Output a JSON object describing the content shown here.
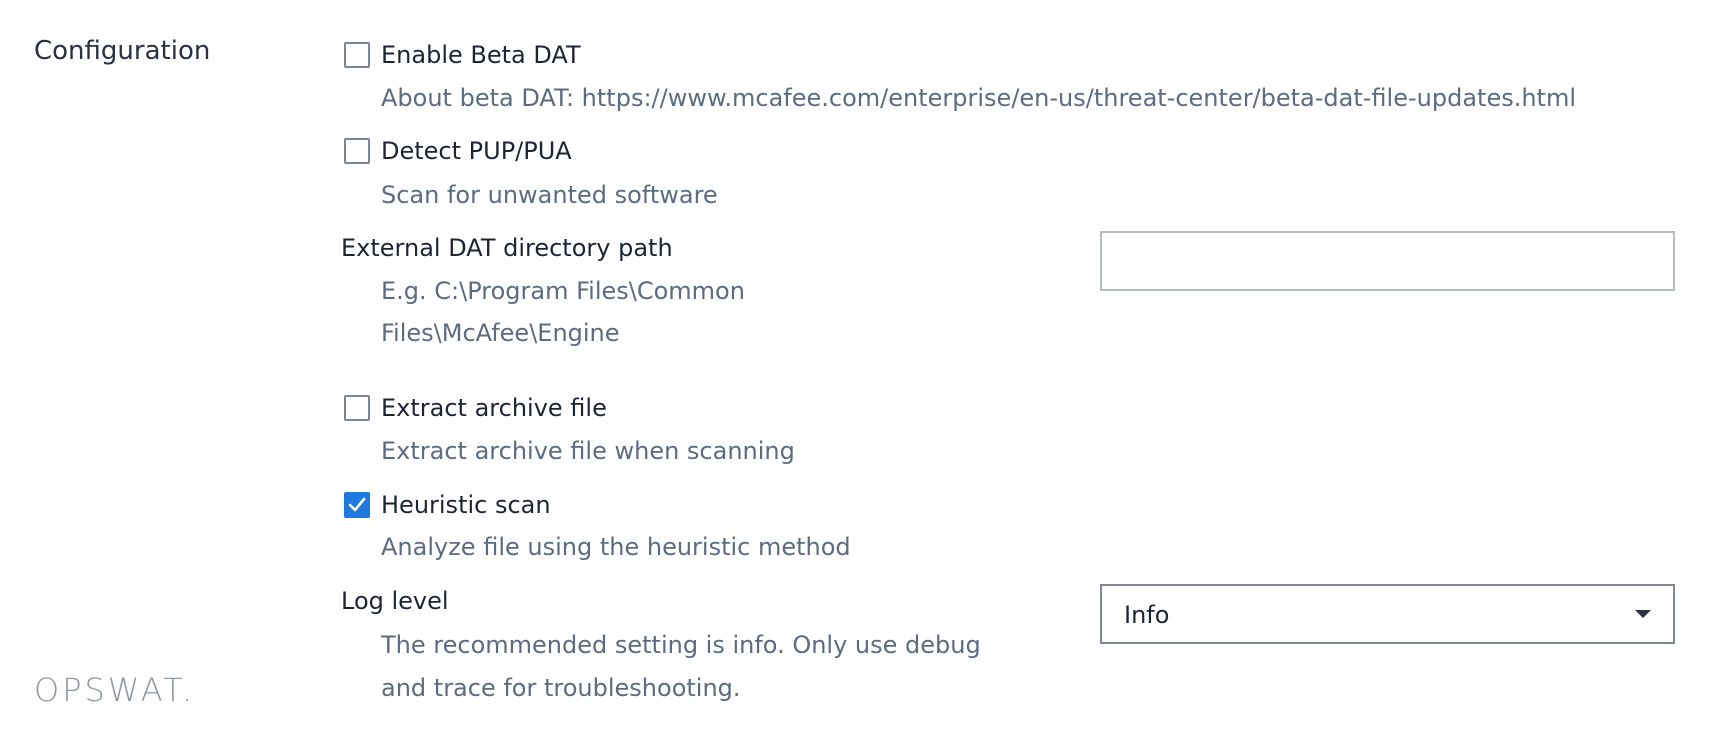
{
  "section": {
    "title": "Configuration"
  },
  "options": {
    "beta_dat": {
      "label": "Enable Beta DAT",
      "description": "About beta DAT: https://www.mcafee.com/enterprise/en-us/threat-center/beta-dat-file-updates.html",
      "checked": false
    },
    "detect_pup": {
      "label": "Detect PUP/PUA",
      "description": "Scan for unwanted software",
      "checked": false
    },
    "external_dat": {
      "label": "External DAT directory path",
      "description_line1": "E.g. C:\\Program Files\\Common",
      "description_line2": "Files\\McAfee\\Engine",
      "value": ""
    },
    "extract_archive": {
      "label": "Extract archive file",
      "description": "Extract archive file when scanning",
      "checked": false
    },
    "heuristic_scan": {
      "label": "Heuristic scan",
      "description": "Analyze file using the heuristic method",
      "checked": true
    },
    "log_level": {
      "label": "Log level",
      "description_line1": "The recommended setting is info. Only use debug",
      "description_line2": "and trace for troubleshooting.",
      "selected": "Info"
    }
  },
  "branding": {
    "logo_text": "OPSWAT."
  },
  "colors": {
    "accent": "#1f7ae0",
    "label": "#1d2433",
    "description": "#5c6a82",
    "logo": "#8e95a3"
  },
  "icons": {
    "checkmark": "check-icon",
    "dropdown": "chevron-down-icon"
  }
}
